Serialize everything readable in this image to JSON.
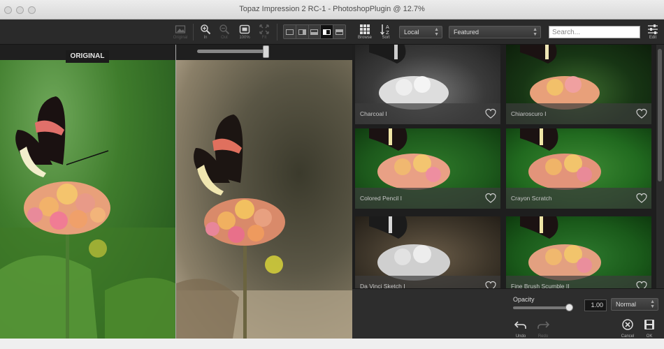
{
  "window": {
    "title": "Topaz Impression 2 RC-1 - PhotoshopPlugin @ 12.7%"
  },
  "preview_toolbar": {
    "original_label": "Original",
    "zoom_in_label": "In",
    "zoom_out_label": "Out",
    "zoom_100_label": "100%",
    "fit_label": "Fit"
  },
  "preview": {
    "original_badge": "ORIGINAL"
  },
  "browser_toolbar": {
    "browse_label": "Browse",
    "sort_label": "Sort",
    "scope_selected": "Local",
    "collection_selected": "Featured",
    "search_placeholder": "Search...",
    "edit_label": "Edit"
  },
  "presets": [
    {
      "name": "Charcoal I",
      "favorite": false
    },
    {
      "name": "Chiaroscuro I",
      "favorite": false
    },
    {
      "name": "Colored Pencil I",
      "favorite": false
    },
    {
      "name": "Crayon Scratch",
      "favorite": false
    },
    {
      "name": "Da Vinci Sketch I",
      "favorite": false
    },
    {
      "name": "Fine Brush Scumble II",
      "favorite": false
    }
  ],
  "adjust": {
    "opacity_label": "Opacity",
    "opacity_value": "1.00",
    "opacity_fraction": 1.0,
    "blend_mode": "Normal"
  },
  "actions": {
    "undo_label": "Undo",
    "redo_label": "Redo",
    "cancel_label": "Cancel",
    "ok_label": "OK"
  }
}
